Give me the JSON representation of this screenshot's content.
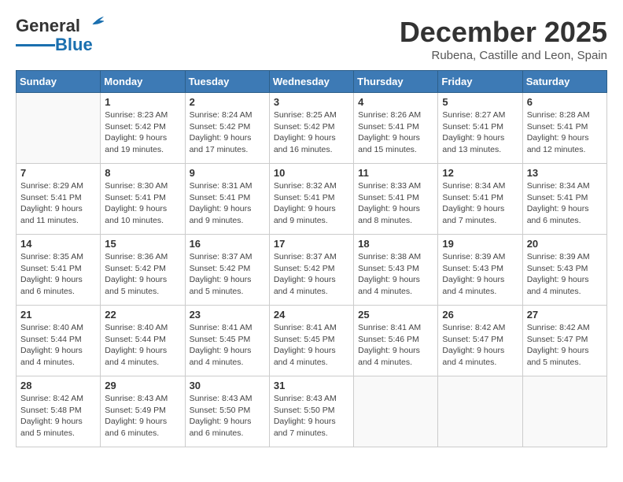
{
  "header": {
    "logo_general": "General",
    "logo_blue": "Blue",
    "month_title": "December 2025",
    "subtitle": "Rubena, Castille and Leon, Spain"
  },
  "days_of_week": [
    "Sunday",
    "Monday",
    "Tuesday",
    "Wednesday",
    "Thursday",
    "Friday",
    "Saturday"
  ],
  "weeks": [
    [
      {
        "day": "",
        "sunrise": "",
        "sunset": "",
        "daylight": ""
      },
      {
        "day": "1",
        "sunrise": "Sunrise: 8:23 AM",
        "sunset": "Sunset: 5:42 PM",
        "daylight": "Daylight: 9 hours and 19 minutes."
      },
      {
        "day": "2",
        "sunrise": "Sunrise: 8:24 AM",
        "sunset": "Sunset: 5:42 PM",
        "daylight": "Daylight: 9 hours and 17 minutes."
      },
      {
        "day": "3",
        "sunrise": "Sunrise: 8:25 AM",
        "sunset": "Sunset: 5:42 PM",
        "daylight": "Daylight: 9 hours and 16 minutes."
      },
      {
        "day": "4",
        "sunrise": "Sunrise: 8:26 AM",
        "sunset": "Sunset: 5:41 PM",
        "daylight": "Daylight: 9 hours and 15 minutes."
      },
      {
        "day": "5",
        "sunrise": "Sunrise: 8:27 AM",
        "sunset": "Sunset: 5:41 PM",
        "daylight": "Daylight: 9 hours and 13 minutes."
      },
      {
        "day": "6",
        "sunrise": "Sunrise: 8:28 AM",
        "sunset": "Sunset: 5:41 PM",
        "daylight": "Daylight: 9 hours and 12 minutes."
      }
    ],
    [
      {
        "day": "7",
        "sunrise": "Sunrise: 8:29 AM",
        "sunset": "Sunset: 5:41 PM",
        "daylight": "Daylight: 9 hours and 11 minutes."
      },
      {
        "day": "8",
        "sunrise": "Sunrise: 8:30 AM",
        "sunset": "Sunset: 5:41 PM",
        "daylight": "Daylight: 9 hours and 10 minutes."
      },
      {
        "day": "9",
        "sunrise": "Sunrise: 8:31 AM",
        "sunset": "Sunset: 5:41 PM",
        "daylight": "Daylight: 9 hours and 9 minutes."
      },
      {
        "day": "10",
        "sunrise": "Sunrise: 8:32 AM",
        "sunset": "Sunset: 5:41 PM",
        "daylight": "Daylight: 9 hours and 9 minutes."
      },
      {
        "day": "11",
        "sunrise": "Sunrise: 8:33 AM",
        "sunset": "Sunset: 5:41 PM",
        "daylight": "Daylight: 9 hours and 8 minutes."
      },
      {
        "day": "12",
        "sunrise": "Sunrise: 8:34 AM",
        "sunset": "Sunset: 5:41 PM",
        "daylight": "Daylight: 9 hours and 7 minutes."
      },
      {
        "day": "13",
        "sunrise": "Sunrise: 8:34 AM",
        "sunset": "Sunset: 5:41 PM",
        "daylight": "Daylight: 9 hours and 6 minutes."
      }
    ],
    [
      {
        "day": "14",
        "sunrise": "Sunrise: 8:35 AM",
        "sunset": "Sunset: 5:41 PM",
        "daylight": "Daylight: 9 hours and 6 minutes."
      },
      {
        "day": "15",
        "sunrise": "Sunrise: 8:36 AM",
        "sunset": "Sunset: 5:42 PM",
        "daylight": "Daylight: 9 hours and 5 minutes."
      },
      {
        "day": "16",
        "sunrise": "Sunrise: 8:37 AM",
        "sunset": "Sunset: 5:42 PM",
        "daylight": "Daylight: 9 hours and 5 minutes."
      },
      {
        "day": "17",
        "sunrise": "Sunrise: 8:37 AM",
        "sunset": "Sunset: 5:42 PM",
        "daylight": "Daylight: 9 hours and 4 minutes."
      },
      {
        "day": "18",
        "sunrise": "Sunrise: 8:38 AM",
        "sunset": "Sunset: 5:43 PM",
        "daylight": "Daylight: 9 hours and 4 minutes."
      },
      {
        "day": "19",
        "sunrise": "Sunrise: 8:39 AM",
        "sunset": "Sunset: 5:43 PM",
        "daylight": "Daylight: 9 hours and 4 minutes."
      },
      {
        "day": "20",
        "sunrise": "Sunrise: 8:39 AM",
        "sunset": "Sunset: 5:43 PM",
        "daylight": "Daylight: 9 hours and 4 minutes."
      }
    ],
    [
      {
        "day": "21",
        "sunrise": "Sunrise: 8:40 AM",
        "sunset": "Sunset: 5:44 PM",
        "daylight": "Daylight: 9 hours and 4 minutes."
      },
      {
        "day": "22",
        "sunrise": "Sunrise: 8:40 AM",
        "sunset": "Sunset: 5:44 PM",
        "daylight": "Daylight: 9 hours and 4 minutes."
      },
      {
        "day": "23",
        "sunrise": "Sunrise: 8:41 AM",
        "sunset": "Sunset: 5:45 PM",
        "daylight": "Daylight: 9 hours and 4 minutes."
      },
      {
        "day": "24",
        "sunrise": "Sunrise: 8:41 AM",
        "sunset": "Sunset: 5:45 PM",
        "daylight": "Daylight: 9 hours and 4 minutes."
      },
      {
        "day": "25",
        "sunrise": "Sunrise: 8:41 AM",
        "sunset": "Sunset: 5:46 PM",
        "daylight": "Daylight: 9 hours and 4 minutes."
      },
      {
        "day": "26",
        "sunrise": "Sunrise: 8:42 AM",
        "sunset": "Sunset: 5:47 PM",
        "daylight": "Daylight: 9 hours and 4 minutes."
      },
      {
        "day": "27",
        "sunrise": "Sunrise: 8:42 AM",
        "sunset": "Sunset: 5:47 PM",
        "daylight": "Daylight: 9 hours and 5 minutes."
      }
    ],
    [
      {
        "day": "28",
        "sunrise": "Sunrise: 8:42 AM",
        "sunset": "Sunset: 5:48 PM",
        "daylight": "Daylight: 9 hours and 5 minutes."
      },
      {
        "day": "29",
        "sunrise": "Sunrise: 8:43 AM",
        "sunset": "Sunset: 5:49 PM",
        "daylight": "Daylight: 9 hours and 6 minutes."
      },
      {
        "day": "30",
        "sunrise": "Sunrise: 8:43 AM",
        "sunset": "Sunset: 5:50 PM",
        "daylight": "Daylight: 9 hours and 6 minutes."
      },
      {
        "day": "31",
        "sunrise": "Sunrise: 8:43 AM",
        "sunset": "Sunset: 5:50 PM",
        "daylight": "Daylight: 9 hours and 7 minutes."
      },
      {
        "day": "",
        "sunrise": "",
        "sunset": "",
        "daylight": ""
      },
      {
        "day": "",
        "sunrise": "",
        "sunset": "",
        "daylight": ""
      },
      {
        "day": "",
        "sunrise": "",
        "sunset": "",
        "daylight": ""
      }
    ]
  ]
}
